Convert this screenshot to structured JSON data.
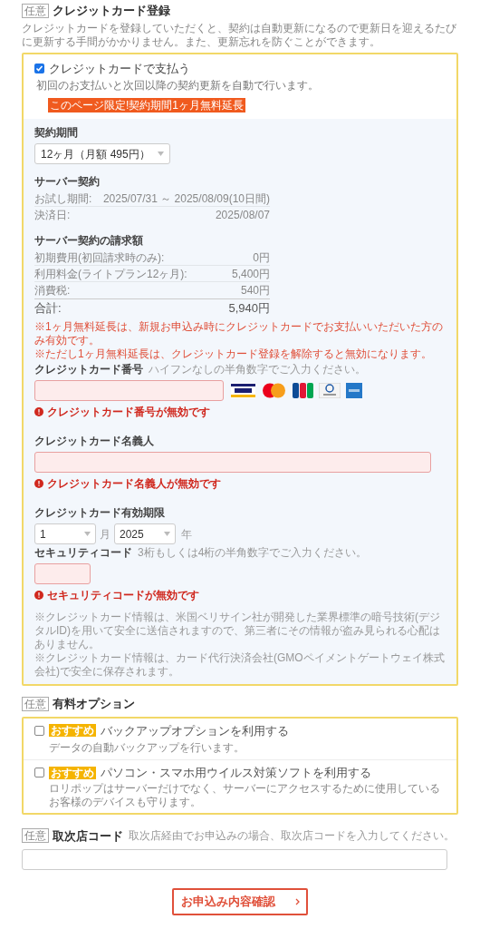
{
  "credit_card": {
    "tag": "任意",
    "title": "クレジットカード登録",
    "description": "クレジットカードを登録していただくと、契約は自動更新になるので更新日を迎えるたびに更新する手間がかかりません。また、更新忘れを防ぐことができます。",
    "pay_option": {
      "label": "クレジットカードで支払う",
      "note": "初回のお支払いと次回以降の契約更新を自動で行います。",
      "checked": true
    },
    "promo_badge": "このページ限定!契約期間1ヶ月無料延長",
    "contract_period": {
      "label": "契約期間",
      "value": "12ヶ月（月額 495円）"
    },
    "server_contract": {
      "title": "サーバー契約",
      "rows": [
        {
          "label": "お試し期間:",
          "value": "2025/07/31 ～ 2025/08/09(10日間)"
        },
        {
          "label": "決済日:",
          "value": "2025/08/07"
        }
      ]
    },
    "billing": {
      "title": "サーバー契約の請求額",
      "rows": [
        {
          "label": "初期費用(初回請求時のみ):",
          "value": "0円"
        },
        {
          "label": "利用料金(ライトプラン12ヶ月):",
          "value": "5,400円"
        },
        {
          "label": "消費税:",
          "value": "540円"
        }
      ],
      "total": {
        "label": "合計:",
        "value": "5,940円"
      }
    },
    "promo_notes": [
      "※1ヶ月無料延長は、新規お申込み時にクレジットカードでお支払いいただいた方のみ有効です。",
      "※ただし1ヶ月無料延長は、クレジットカード登録を解除すると無効になります。"
    ],
    "fields": [
      {
        "kind": "card_number",
        "label": "クレジットカード番号",
        "hint": "ハイフンなしの半角数字でご入力ください。",
        "invalid": true,
        "error": "クレジットカード番号が無効です"
      },
      {
        "kind": "text",
        "label": "クレジットカード名義人",
        "invalid": true,
        "error": "クレジットカード名義人が無効です"
      },
      {
        "kind": "expiry",
        "label": "クレジットカード有効期限",
        "month": "1",
        "month_unit": "月",
        "year": "2025",
        "year_unit": "年"
      },
      {
        "kind": "short",
        "label": "セキュリティコード",
        "hint": "3桁もしくは4桁の半角数字でご入力ください。",
        "invalid": true,
        "error": "セキュリティコードが無効です"
      }
    ],
    "security_notes": [
      "※クレジットカード情報は、米国ベリサイン社が開発した業界標準の暗号技術(デジタルID)を用いて安全に送信されますので、第三者にその情報が盗み見られる心配はありません。",
      "※クレジットカード情報は、カード代行決済会社(GMOペイメントゲートウェイ株式会社)で安全に保存されます。"
    ]
  },
  "paid_options": {
    "tag": "任意",
    "title": "有料オプション",
    "items": [
      {
        "kind": "inline",
        "badge": "おすすめ",
        "label": "バックアップオプションを利用する",
        "note": "データの自動バックアップを行います。",
        "checked": false
      },
      {
        "kind": "below",
        "badge": "おすすめ",
        "label": "パソコン・スマホ用ウイルス対策ソフトを利用する",
        "note": "ロリポップはサーバーだけでなく、サーバーにアクセスするために使用しているお客様のデバイスも守ります。",
        "checked": false
      }
    ]
  },
  "agent_code": {
    "tag": "任意",
    "title": "取次店コード",
    "hint": "取次店経由でお申込みの場合、取次店コードを入力してください。"
  },
  "confirm_button": "お申込み内容確認"
}
